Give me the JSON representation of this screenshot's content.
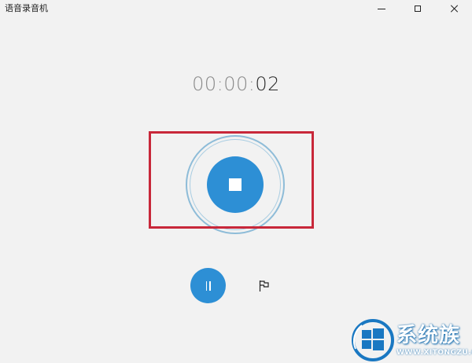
{
  "app": {
    "title": "语音录音机"
  },
  "window_controls": {
    "minimize_icon": "minimize-icon",
    "maximize_icon": "maximize-icon",
    "close_icon": "close-icon"
  },
  "timer": {
    "hours": "00",
    "sep1": ":",
    "minutes": "00",
    "sep2": ":",
    "seconds": "02"
  },
  "controls": {
    "stop_icon": "stop-icon",
    "pause_icon": "pause-icon",
    "flag_icon": "flag-icon"
  },
  "watermark": {
    "brand": "系统族",
    "url": "WWW.XITONGZU.COM"
  },
  "colors": {
    "accent": "#2d8fd5",
    "highlight": "#c8283a",
    "background": "#f2f2f2"
  }
}
